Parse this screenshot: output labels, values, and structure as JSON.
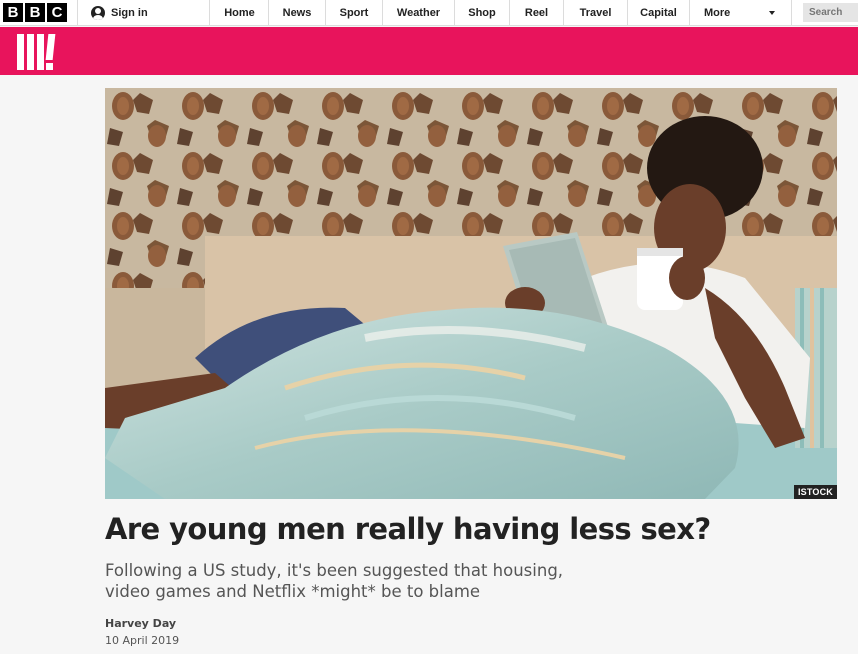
{
  "header": {
    "logo_letters": [
      "B",
      "B",
      "C"
    ],
    "signin_label": "Sign in",
    "nav": [
      {
        "label": "Home"
      },
      {
        "label": "News"
      },
      {
        "label": "Sport"
      },
      {
        "label": "Weather"
      },
      {
        "label": "Shop"
      },
      {
        "label": "Reel"
      },
      {
        "label": "Travel"
      },
      {
        "label": "Capital"
      }
    ],
    "more_label": "More",
    "search_placeholder": "Search"
  },
  "brand": {
    "name": "BBC Three",
    "color": "#e8145c"
  },
  "hero": {
    "credit": "ISTOCK"
  },
  "article": {
    "headline": "Are young men really having less sex?",
    "standfirst": "Following a US study, it's been suggested that housing, video games and Netflix *might* be to blame",
    "author": "Harvey Day",
    "date": "10 April 2019"
  }
}
